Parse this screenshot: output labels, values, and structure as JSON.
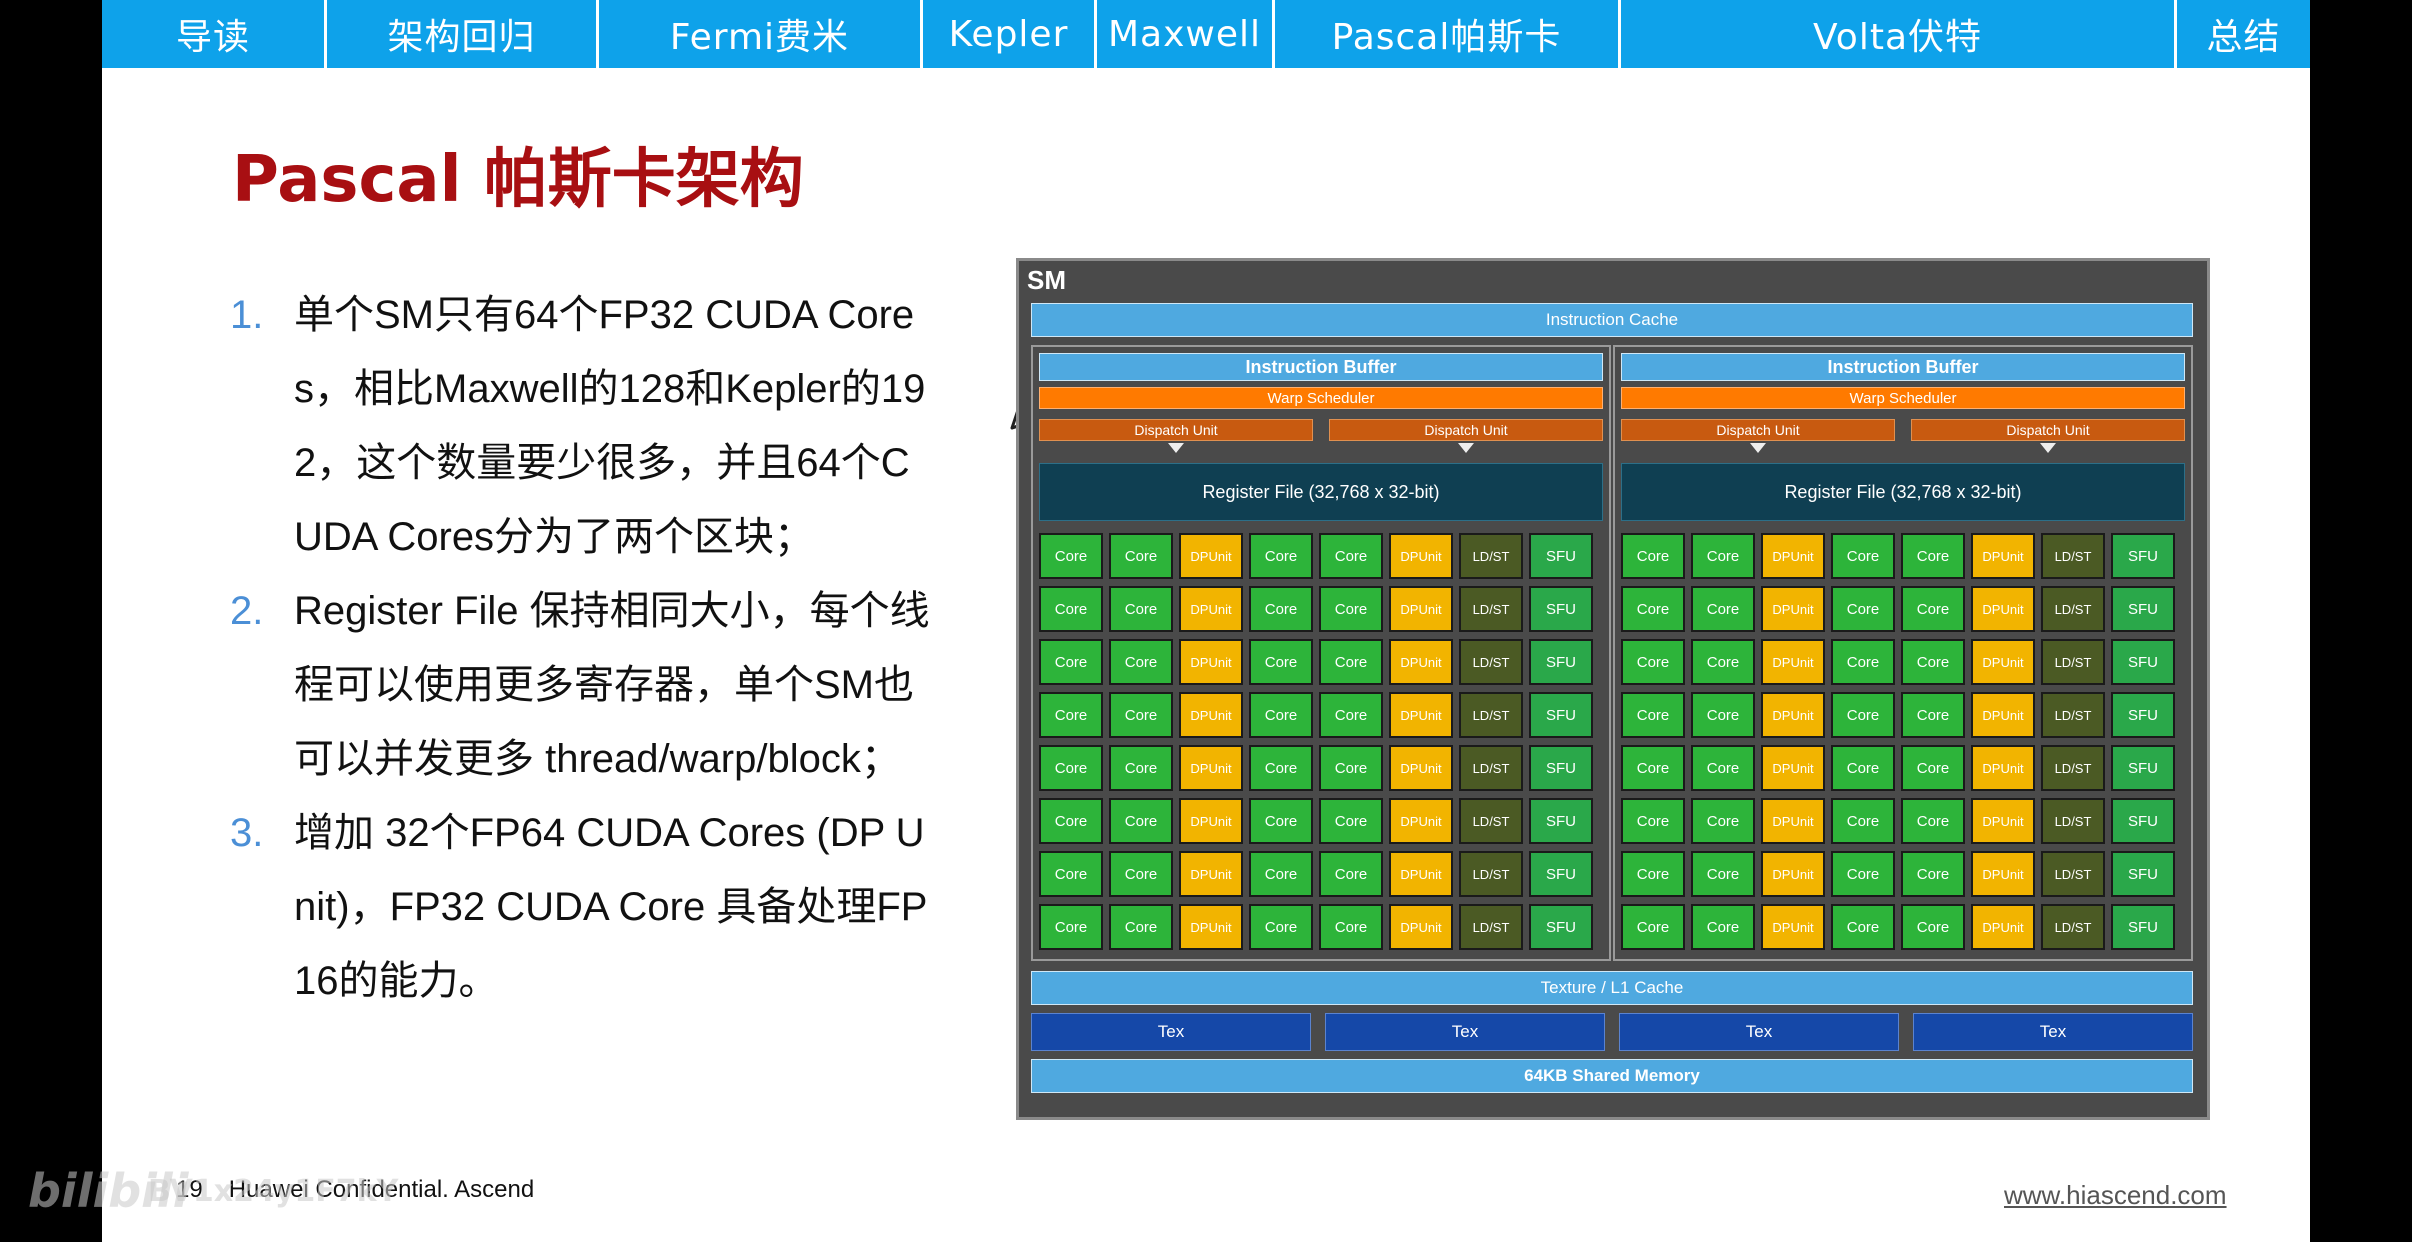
{
  "nav": {
    "tabs": [
      {
        "label": "导读"
      },
      {
        "label": "架构回归"
      },
      {
        "label": "Fermi费米"
      },
      {
        "label": "Kepler"
      },
      {
        "label": "Maxwell"
      },
      {
        "label": "Pascal帕斯卡"
      },
      {
        "label": "Volta伏特"
      },
      {
        "label": "总结"
      }
    ]
  },
  "slide": {
    "title": "Pascal 帕斯卡架构",
    "points": [
      {
        "num": "1.",
        "text": "单个SM只有64个FP32 CUDA Cores，相比Maxwell的128和Kepler的192，这个数量要少很多，并且64个CUDA Cores分为了两个区块；"
      },
      {
        "num": "2.",
        "text": "Register File 保持相同大小，每个线程可以使用更多寄存器，单个SM也可以并发更多 thread/warp/block；"
      },
      {
        "num": "3.",
        "text": "增加 32个FP64 CUDA Cores (DP Unit)，FP32 CUDA Core 具备处理FP16的能力。"
      }
    ]
  },
  "diagram": {
    "sm_label": "SM",
    "instruction_cache": "Instruction Cache",
    "instruction_buffer": "Instruction Buffer",
    "warp_scheduler": "Warp Scheduler",
    "dispatch_unit": "Dispatch Unit",
    "register_file": "Register File (32,768 x 32-bit)",
    "cell_core": "Core",
    "cell_dp_1": "DP",
    "cell_dp_2": "Unit",
    "cell_ldst": "LD/ST",
    "cell_sfu": "SFU",
    "texture_l1": "Texture / L1 Cache",
    "tex": "Tex",
    "shared_memory": "64KB Shared Memory"
  },
  "footer": {
    "page": "19",
    "confidential": "Huawei Confidential. Ascend",
    "url": "www.hiascend.com"
  },
  "watermark": {
    "logo": "bilibili",
    "bv": "BV1x24y1F7kY"
  },
  "colors": {
    "nav_bg": "#0ea2ea",
    "title": "#a80f12",
    "list_number": "#4b8fd6",
    "core": "#2db43a",
    "dp_unit": "#f2b400",
    "ld_st": "#4b5a24",
    "warp_scheduler": "#ff7a00",
    "tex": "#1548a8"
  }
}
